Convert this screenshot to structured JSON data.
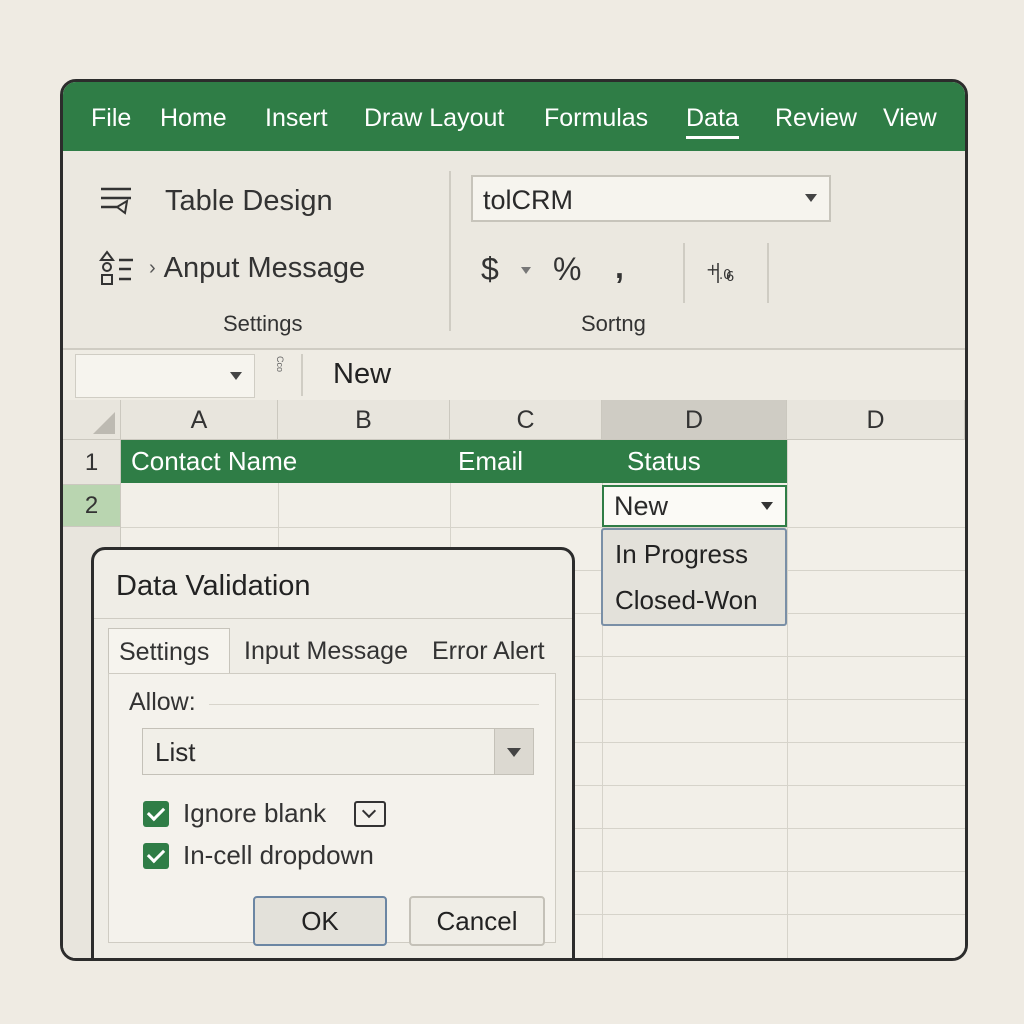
{
  "menu": {
    "items": [
      "File",
      "Home",
      "Insert",
      "Draw Layout",
      "Formulas",
      "Data",
      "Review",
      "View"
    ],
    "active": "Data"
  },
  "ribbon": {
    "table_design": "Table Design",
    "input_message": "Anput Message",
    "settings_group": "Settings",
    "combo_value": "tolCRM",
    "currency": "$",
    "percent": "%",
    "comma": ",",
    "sort_group": "Sortng"
  },
  "formula_bar": {
    "name_box": "",
    "fx_label": "Cco",
    "value": "New"
  },
  "grid": {
    "columns": [
      "A",
      "B",
      "C",
      "D",
      "D"
    ],
    "rows": [
      "1",
      "2"
    ],
    "headers": {
      "contact_name": "Contact Name",
      "email": "Email",
      "status": "Status"
    },
    "active_cell_value": "New",
    "dropdown_options": [
      "In Progress",
      "Closed-Won"
    ]
  },
  "dialog": {
    "title": "Data Validation",
    "tabs": [
      "Settings",
      "Input Message",
      "Error Alert"
    ],
    "allow_label": "Allow:",
    "allow_value": "List",
    "ignore_blank": "Ignore blank",
    "in_cell_dropdown": "In-cell dropdown",
    "ok": "OK",
    "cancel": "Cancel"
  },
  "colors": {
    "accent": "#2f7d46",
    "background": "#efebe3"
  }
}
